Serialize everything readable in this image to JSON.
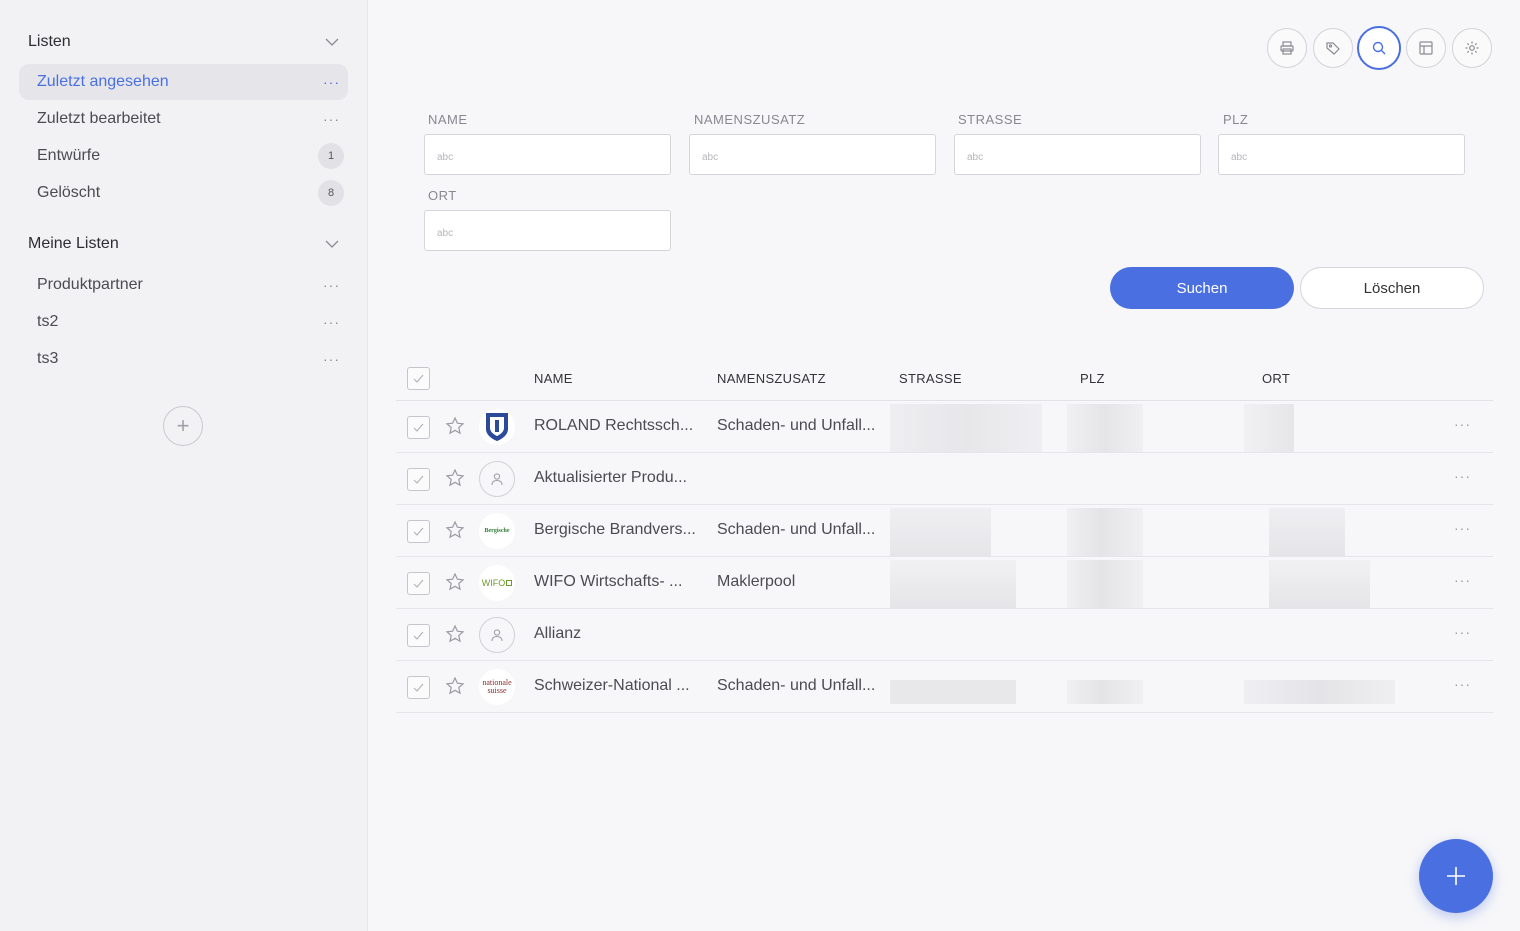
{
  "sidebar": {
    "sections": [
      {
        "title": "Listen",
        "items": [
          {
            "label": "Zuletzt angesehen",
            "active": true
          },
          {
            "label": "Zuletzt bearbeitet"
          },
          {
            "label": "Entwürfe",
            "count": "1"
          },
          {
            "label": "Gelöscht",
            "count": "8"
          }
        ]
      },
      {
        "title": "Meine Listen",
        "items": [
          {
            "label": "Produktpartner"
          },
          {
            "label": "ts2"
          },
          {
            "label": "ts3"
          }
        ]
      }
    ],
    "more_label": "···",
    "add_icon": "+"
  },
  "toolbar": {
    "buttons": [
      "printer-icon",
      "tag-icon",
      "search-icon",
      "layout-icon",
      "gear-icon"
    ],
    "active": "search-icon"
  },
  "search": {
    "fields": [
      {
        "label": "NAME",
        "placeholder": "abc"
      },
      {
        "label": "NAMENSZUSATZ",
        "placeholder": "abc"
      },
      {
        "label": "STRASSE",
        "placeholder": "abc"
      },
      {
        "label": "PLZ",
        "placeholder": "abc"
      },
      {
        "label": "ORT",
        "placeholder": "abc"
      }
    ],
    "submit_label": "Suchen",
    "clear_label": "Löschen"
  },
  "table": {
    "columns": [
      "NAME",
      "NAMENSZUSATZ",
      "STRASSE",
      "PLZ",
      "ORT"
    ],
    "rows": [
      {
        "name": "ROLAND Rechtssch...",
        "zusatz": "Schaden- und Unfall...",
        "logo": "roland-logo",
        "redacted": true
      },
      {
        "name": "Aktualisierter Produ...",
        "zusatz": "",
        "logo": "person-icon",
        "redacted": false
      },
      {
        "name": "Bergische Brandvers...",
        "zusatz": "Schaden- und Unfall...",
        "logo": "bergische-logo",
        "logo_text": "Bergische",
        "redacted": true
      },
      {
        "name": "WIFO Wirtschafts- ...",
        "zusatz": "Maklerpool",
        "logo": "wifo-logo",
        "logo_text": "WIFO",
        "redacted": true
      },
      {
        "name": "Allianz",
        "zusatz": "",
        "logo": "person-icon",
        "redacted": false
      },
      {
        "name": "Schweizer-National ...",
        "zusatz": "Schaden- und Unfall...",
        "logo": "nationale-suisse-logo",
        "logo_text": "nationale suisse",
        "redacted": true
      }
    ],
    "row_more_label": "···"
  },
  "colors": {
    "accent": "#4a6fe0",
    "sidebar_bg": "#f2f2f4",
    "main_bg": "#f7f7f9"
  }
}
